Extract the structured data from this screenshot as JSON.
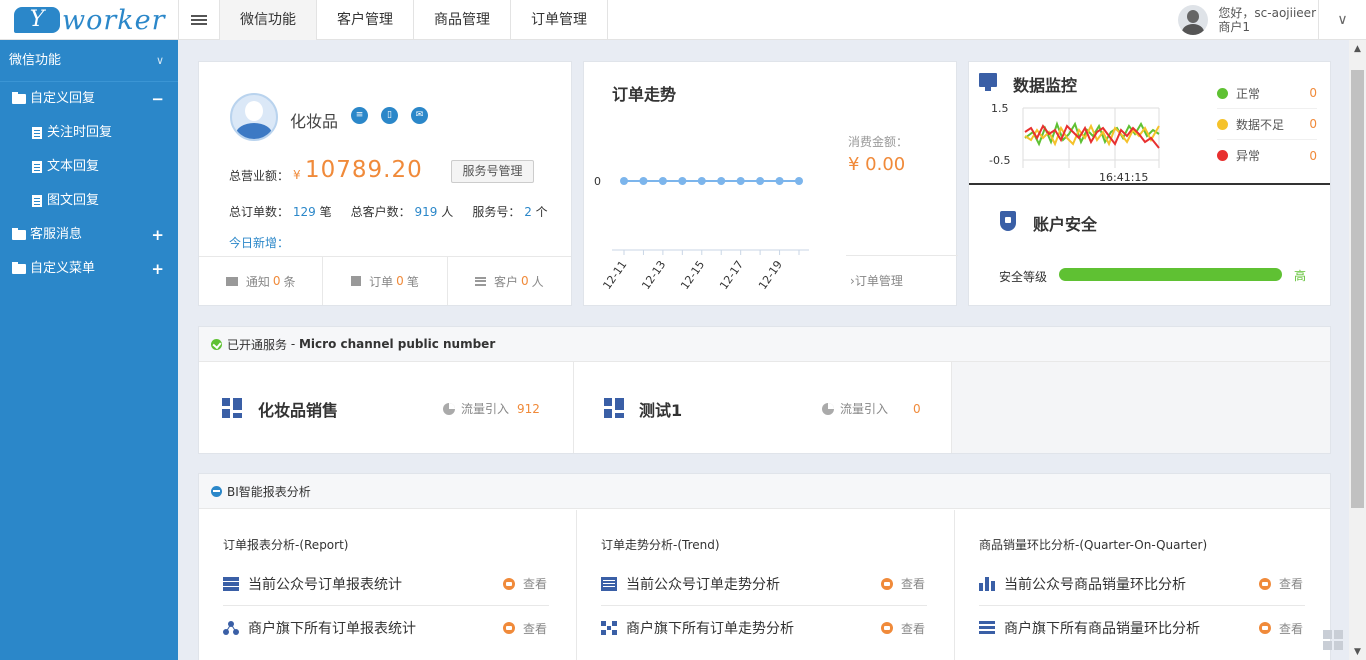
{
  "logo": {
    "mark": "Y",
    "word": "worker"
  },
  "topnav": {
    "tabs": [
      {
        "label": "微信功能"
      },
      {
        "label": "客户管理"
      },
      {
        "label": "商品管理"
      },
      {
        "label": "订单管理"
      }
    ]
  },
  "user": {
    "greeting": "您好，sc-aojiieer",
    "role": "商户1"
  },
  "sidebar": {
    "header": "微信功能",
    "items": [
      {
        "label": "自定义回复",
        "toggle": "−"
      },
      {
        "label": "关注时回复"
      },
      {
        "label": "文本回复"
      },
      {
        "label": "图文回复"
      },
      {
        "label": "客服消息",
        "toggle": "+"
      },
      {
        "label": "自定义菜单",
        "toggle": "+"
      }
    ]
  },
  "profile": {
    "name": "化妆品",
    "revenue_label": "总营业额：",
    "currency": "¥",
    "revenue": "10789.20",
    "service_button": "服务号管理",
    "orders_label": "总订单数：",
    "orders": "129",
    "orders_unit": "笔",
    "customers_label": "总客户数：",
    "customers": "919",
    "customers_unit": "人",
    "services_label": "服务号：",
    "services": "2",
    "services_unit": "个",
    "today_label": "今日新增：",
    "footer": [
      {
        "label": "通知",
        "count": "0",
        "unit": "条"
      },
      {
        "label": "订单",
        "count": "0",
        "unit": "笔"
      },
      {
        "label": "客户",
        "count": "0",
        "unit": "人"
      }
    ]
  },
  "trend": {
    "title": "订单走势",
    "consumption_label": "消费金额：",
    "consumption_value": "¥ 0.00",
    "link": "订单管理"
  },
  "chart_data": {
    "type": "line",
    "title": "订单走势",
    "x": [
      "12-11",
      "12-12",
      "12-13",
      "12-14",
      "12-15",
      "12-16",
      "12-17",
      "12-18",
      "12-19",
      "12-20"
    ],
    "tick_labels": [
      "12-11",
      "12-13",
      "12-15",
      "12-17",
      "12-19"
    ],
    "values": [
      0,
      0,
      0,
      0,
      0,
      0,
      0,
      0,
      0,
      0
    ],
    "y_ticks": [
      "0"
    ],
    "color": "#7cb5ec"
  },
  "monitor": {
    "title": "数据监控",
    "y_ticks": [
      "1.5",
      "-0.5"
    ],
    "time": "16:41:15",
    "legend": [
      {
        "label": "正常",
        "count": "0",
        "color": "#5fc133"
      },
      {
        "label": "数据不足",
        "count": "0",
        "color": "#f5c22b"
      },
      {
        "label": "异常",
        "count": "0",
        "color": "#e8302f"
      }
    ]
  },
  "security": {
    "title": "账户安全",
    "level_label": "安全等级",
    "level": "高",
    "level_fraction": 1.0
  },
  "services": {
    "header_prefix": "已开通服务",
    "header_sep": " - ",
    "header_name": "Micro channel public number",
    "items": [
      {
        "name": "化妆品销售",
        "flow_label": "流量引入",
        "flow": "912"
      },
      {
        "name": "测试1",
        "flow_label": "流量引入",
        "flow": "0"
      }
    ]
  },
  "bi": {
    "header": "BI智能报表分析",
    "columns": [
      {
        "title": "订单报表分析-(Report)",
        "rows": [
          {
            "label": "当前公众号订单报表统计",
            "action": "查看"
          },
          {
            "label": "商户旗下所有订单报表统计",
            "action": "查看"
          }
        ]
      },
      {
        "title": "订单走势分析-(Trend)",
        "rows": [
          {
            "label": "当前公众号订单走势分析",
            "action": "查看"
          },
          {
            "label": "商户旗下所有订单走势分析",
            "action": "查看"
          }
        ]
      },
      {
        "title": "商品销量环比分析-(Quarter-On-Quarter)",
        "rows": [
          {
            "label": "当前公众号商品销量环比分析",
            "action": "查看"
          },
          {
            "label": "商户旗下所有商品销量环比分析",
            "action": "查看"
          }
        ]
      }
    ]
  }
}
